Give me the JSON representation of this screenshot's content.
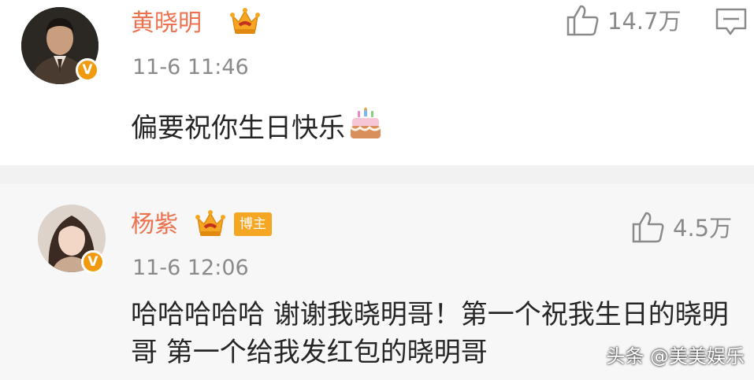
{
  "comments": [
    {
      "username": "黄晓明",
      "timestamp": "11-6 11:46",
      "text": "偏要祝你生日快乐",
      "emoji": "cake-icon",
      "like_count": "14.7万",
      "verified_mark": "V"
    },
    {
      "username": "杨紫",
      "badge": "博主",
      "timestamp": "11-6 12:06",
      "text": "哈哈哈哈哈 谢谢我晓明哥！第一个祝我生日的晓明哥 第一个给我发红包的晓明哥",
      "like_count": "4.5万",
      "verified_mark": "V"
    }
  ],
  "watermark": "头条 @美美娱乐",
  "colors": {
    "username": "#eb7350",
    "verified": "#f29a0e",
    "crown": "#f5a623",
    "meta": "#8a8a8a",
    "body_text": "#262626",
    "reply_bg": "#f7f7f7"
  }
}
